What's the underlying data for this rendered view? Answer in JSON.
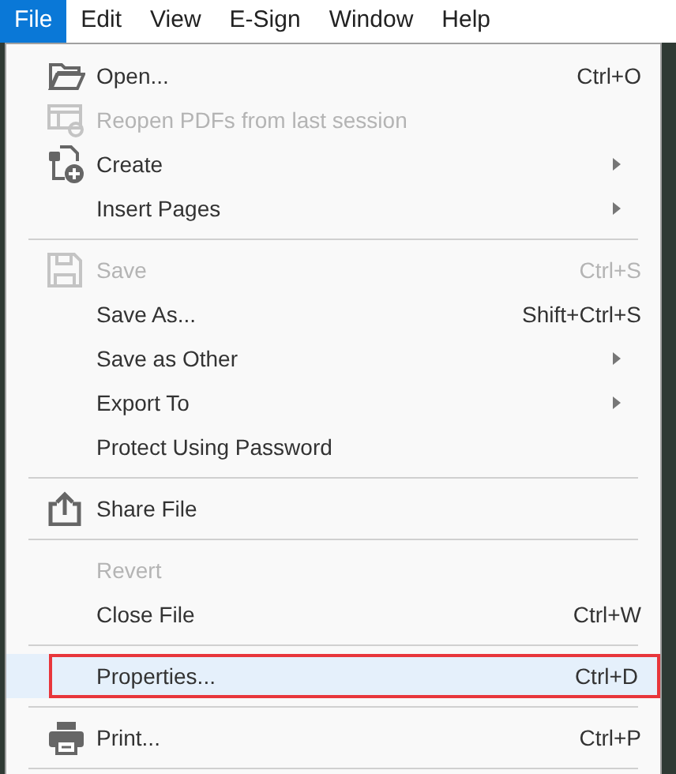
{
  "menubar": [
    {
      "label": "File",
      "selected": true
    },
    {
      "label": "Edit",
      "selected": false
    },
    {
      "label": "View",
      "selected": false
    },
    {
      "label": "E-Sign",
      "selected": false
    },
    {
      "label": "Window",
      "selected": false
    },
    {
      "label": "Help",
      "selected": false
    }
  ],
  "menu": [
    {
      "kind": "item",
      "label": "Open...",
      "shortcut": "Ctrl+O",
      "disabled": false,
      "submenu": false,
      "selected": false,
      "outlined": false
    },
    {
      "kind": "item",
      "label": "Reopen PDFs from last session",
      "disabled": true,
      "submenu": false,
      "selected": false,
      "outlined": false
    },
    {
      "kind": "item",
      "label": "Create",
      "disabled": false,
      "submenu": true,
      "selected": false,
      "outlined": false
    },
    {
      "kind": "item",
      "label": "Insert Pages",
      "disabled": false,
      "submenu": true,
      "selected": false,
      "outlined": false
    },
    {
      "kind": "separator"
    },
    {
      "kind": "item",
      "label": "Save",
      "shortcut": "Ctrl+S",
      "disabled": true,
      "submenu": false,
      "selected": false,
      "outlined": false
    },
    {
      "kind": "item",
      "label": "Save As...",
      "shortcut": "Shift+Ctrl+S",
      "disabled": false,
      "submenu": false,
      "selected": false,
      "outlined": false
    },
    {
      "kind": "item",
      "label": "Save as Other",
      "disabled": false,
      "submenu": true,
      "selected": false,
      "outlined": false
    },
    {
      "kind": "item",
      "label": "Export To",
      "disabled": false,
      "submenu": true,
      "selected": false,
      "outlined": false
    },
    {
      "kind": "item",
      "label": "Protect Using Password",
      "disabled": false,
      "submenu": false,
      "selected": false,
      "outlined": false
    },
    {
      "kind": "separator"
    },
    {
      "kind": "item",
      "label": "Share File",
      "disabled": false,
      "submenu": false,
      "selected": false,
      "outlined": false
    },
    {
      "kind": "separator"
    },
    {
      "kind": "item",
      "label": "Revert",
      "disabled": true,
      "submenu": false,
      "selected": false,
      "outlined": false
    },
    {
      "kind": "item",
      "label": "Close File",
      "shortcut": "Ctrl+W",
      "disabled": false,
      "submenu": false,
      "selected": false,
      "outlined": false
    },
    {
      "kind": "separator"
    },
    {
      "kind": "item",
      "label": "Properties...",
      "shortcut": "Ctrl+D",
      "disabled": false,
      "submenu": false,
      "selected": true,
      "outlined": true
    },
    {
      "kind": "separator"
    },
    {
      "kind": "item",
      "label": "Print...",
      "shortcut": "Ctrl+P",
      "disabled": false,
      "submenu": false,
      "selected": false,
      "outlined": false
    },
    {
      "kind": "separator"
    }
  ]
}
